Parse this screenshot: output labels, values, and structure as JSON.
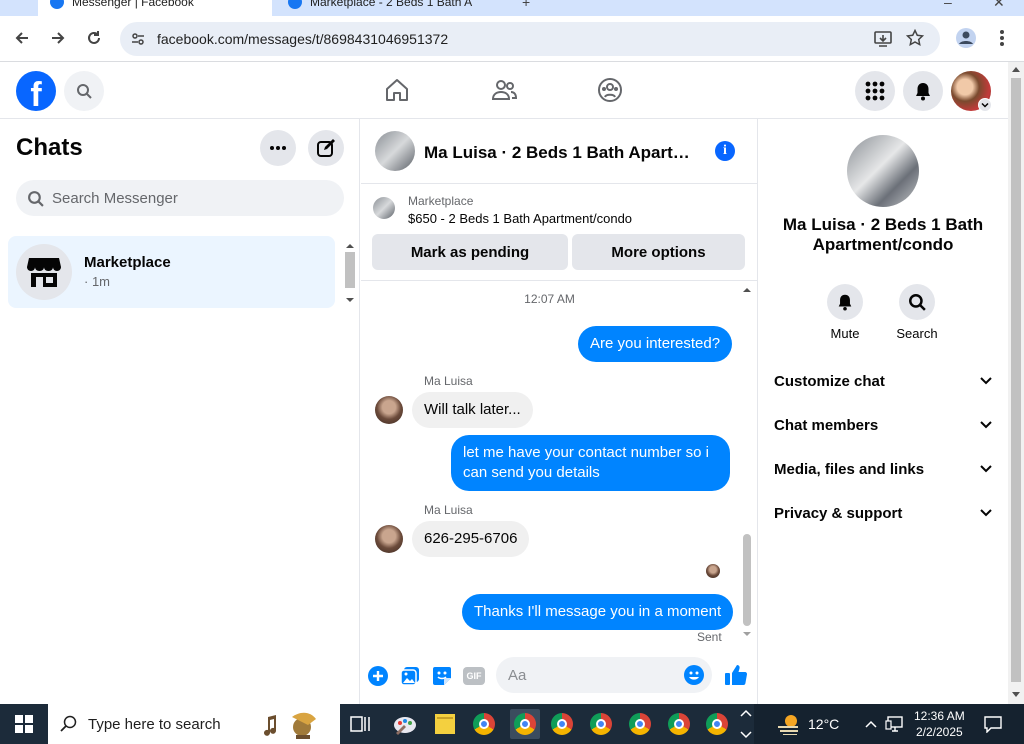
{
  "browser": {
    "tabs": [
      {
        "title": "Messenger | Facebook",
        "active": true
      },
      {
        "title": "Marketplace - 2 Beds 1 Bath A",
        "active": false
      }
    ],
    "url": "facebook.com/messages/t/8698431046951372"
  },
  "colors": {
    "accent": "#0866ff",
    "outgoing_bubble": "#0084ff",
    "incoming_bubble": "#f0f0f0",
    "selected_chat_bg": "#ebf5ff",
    "taskbar": "#1c2b3a"
  },
  "sidebar": {
    "title": "Chats",
    "search_placeholder": "Search Messenger",
    "chats": [
      {
        "name": "Marketplace",
        "time": "· 1m"
      }
    ]
  },
  "conversation": {
    "title": "Ma Luisa · 2 Beds 1 Bath Apartment/condo",
    "listing": {
      "source": "Marketplace",
      "price_title": "$650 - 2 Beds 1 Bath Apartment/condo",
      "mark_pending_label": "Mark as pending",
      "more_options_label": "More options"
    },
    "timestamp": "12:07 AM",
    "messages": [
      {
        "direction": "out",
        "text": "Are you interested?"
      },
      {
        "direction": "in",
        "sender": "Ma Luisa",
        "text": "Will talk later..."
      },
      {
        "direction": "out",
        "text": "let me have your contact number so i can send you details"
      },
      {
        "direction": "in",
        "sender": "Ma Luisa",
        "text": "626-295-6706"
      },
      {
        "direction": "out",
        "text": "Thanks I'll message you in a moment"
      }
    ],
    "status": "Sent",
    "composer_placeholder": "Aa",
    "gif_label": "GIF"
  },
  "info_panel": {
    "title": "Ma Luisa · 2 Beds 1 Bath Apartment/condo",
    "actions": [
      {
        "label": "Mute",
        "icon": "bell-icon"
      },
      {
        "label": "Search",
        "icon": "search-icon"
      }
    ],
    "sections": [
      {
        "label": "Customize chat"
      },
      {
        "label": "Chat members"
      },
      {
        "label": "Media, files and links"
      },
      {
        "label": "Privacy & support"
      }
    ]
  },
  "taskbar": {
    "search_placeholder": "Type here to search",
    "temperature": "12°C",
    "time": "12:36 AM",
    "date": "2/2/2025"
  }
}
